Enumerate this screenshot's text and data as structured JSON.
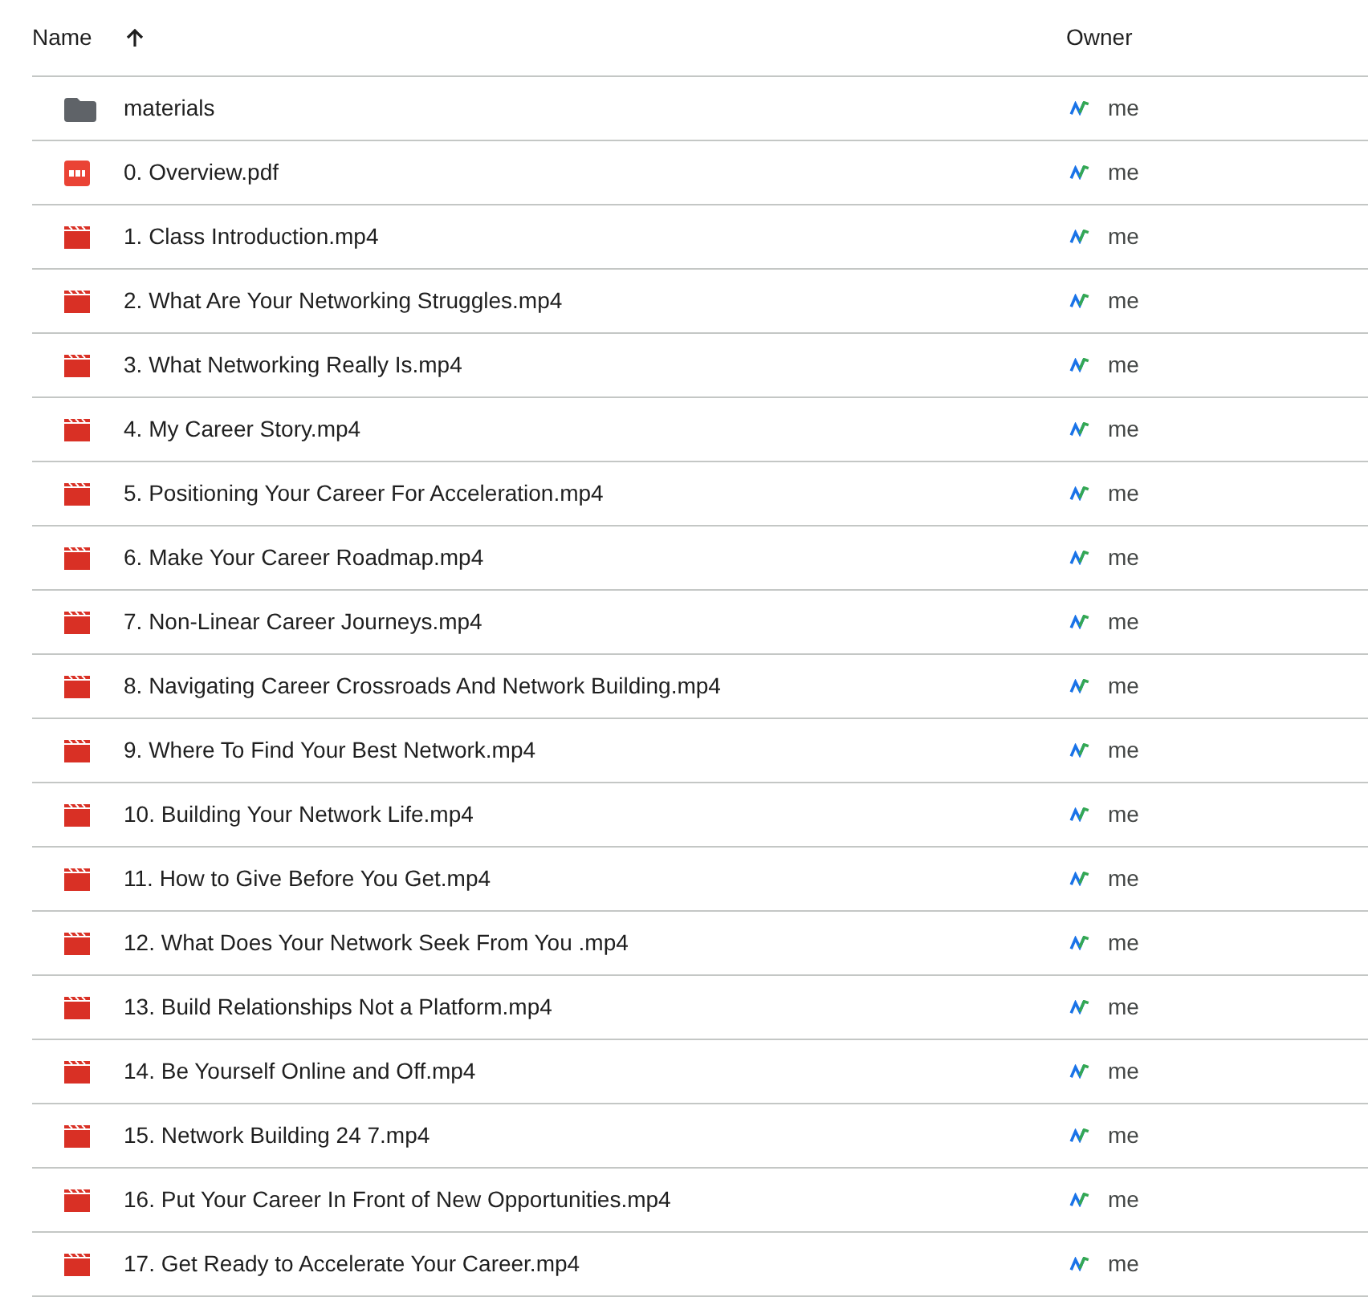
{
  "columns": [
    {
      "label": "Name",
      "sorted": true,
      "ascending": true
    },
    {
      "label": "Owner"
    }
  ],
  "rows": [
    {
      "kind": "folder",
      "name": "materials",
      "owner": "me"
    },
    {
      "kind": "pdf",
      "name": "0. Overview.pdf",
      "owner": "me"
    },
    {
      "kind": "video",
      "name": "1. Class Introduction.mp4",
      "owner": "me"
    },
    {
      "kind": "video",
      "name": "2. What Are Your Networking Struggles.mp4",
      "owner": "me"
    },
    {
      "kind": "video",
      "name": "3. What Networking Really Is.mp4",
      "owner": "me"
    },
    {
      "kind": "video",
      "name": "4. My Career Story.mp4",
      "owner": "me"
    },
    {
      "kind": "video",
      "name": "5. Positioning Your Career For Acceleration.mp4",
      "owner": "me"
    },
    {
      "kind": "video",
      "name": "6. Make Your Career Roadmap.mp4",
      "owner": "me"
    },
    {
      "kind": "video",
      "name": "7. Non-Linear Career Journeys.mp4",
      "owner": "me"
    },
    {
      "kind": "video",
      "name": "8. Navigating Career Crossroads And Network Building.mp4",
      "owner": "me"
    },
    {
      "kind": "video",
      "name": "9. Where To Find Your Best Network.mp4",
      "owner": "me"
    },
    {
      "kind": "video",
      "name": "10. Building Your Network Life.mp4",
      "owner": "me"
    },
    {
      "kind": "video",
      "name": "11. How to Give Before You Get.mp4",
      "owner": "me"
    },
    {
      "kind": "video",
      "name": "12. What Does Your Network Seek From You .mp4",
      "owner": "me"
    },
    {
      "kind": "video",
      "name": "13. Build Relationships Not a Platform.mp4",
      "owner": "me"
    },
    {
      "kind": "video",
      "name": "14. Be Yourself Online and Off.mp4",
      "owner": "me"
    },
    {
      "kind": "video",
      "name": "15. Network Building 24 7.mp4",
      "owner": "me"
    },
    {
      "kind": "video",
      "name": "16. Put Your Career In Front of New Opportunities.mp4",
      "owner": "me"
    },
    {
      "kind": "video",
      "name": "17. Get Ready to Accelerate Your Career.mp4",
      "owner": "me"
    }
  ]
}
